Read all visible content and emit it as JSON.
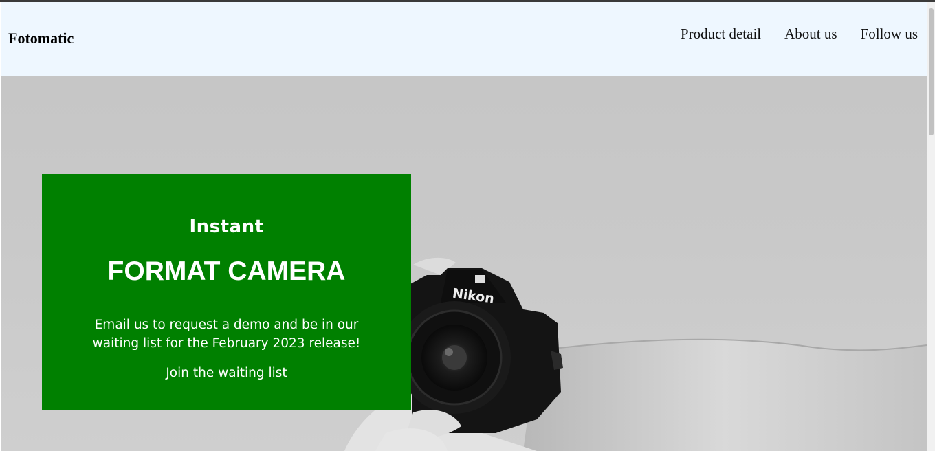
{
  "navbar": {
    "brand": "Fotomatic",
    "links": [
      "Product detail",
      "About us",
      "Follow us"
    ]
  },
  "hero": {
    "background_image": "camera-in-hand-photo",
    "card": {
      "kicker": "Instant",
      "title": "FORMAT CAMERA",
      "text": "Email us to request a demo and be in our waiting list for the February 2023 release!",
      "cta": "Join the waiting list"
    }
  },
  "colors": {
    "navbar_bg": "#eef7ff",
    "card_bg": "#008000",
    "card_text": "#ffffff"
  },
  "icons": {
    "camera_brand_text": "Nikon"
  }
}
